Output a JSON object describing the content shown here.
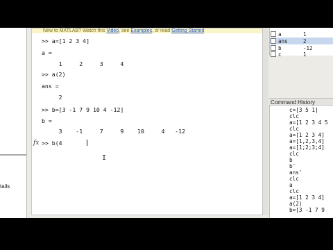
{
  "left_panel": {
    "details_label": "tails"
  },
  "command_window": {
    "banner": {
      "prefix": "New to MATLAB? Watch this",
      "video_link": "Video",
      "sep1": ", see",
      "examples_link": "Examples",
      "sep2": ", or read",
      "started_link": "Getting Started"
    },
    "lines": [
      ">> a=[1 2 3 4]",
      "a =",
      "     1     2     3     4",
      ">> a(2)",
      "ans =",
      "     2",
      ">> b=[3 -1 7 9 10 4 -12]",
      "b =",
      "     3    -1     7     9    10     4   -12",
      ">> b(4"
    ],
    "prompt_glyph": "fx",
    "cursor_glyph": "I"
  },
  "workspace": {
    "rows": [
      {
        "name": "a",
        "value": "1",
        "selected": false
      },
      {
        "name": "ans",
        "value": "2",
        "selected": true
      },
      {
        "name": "b",
        "value": "-12",
        "selected": false
      },
      {
        "name": "c",
        "value": "1",
        "selected": false
      }
    ]
  },
  "command_history": {
    "title": "Command History",
    "items": [
      "c=[3 5 1]",
      "clc",
      "a=[1 2 3 4 5",
      "clc",
      "a=[1 2 3 4]",
      "a=[1,2,3,4]",
      "a=[1;2;3;4]",
      "clc",
      "b",
      "b'",
      "ans'",
      "clc",
      "a",
      "clc",
      "a=[1 2 3 4]",
      "a(2)",
      "b=[3 -1 7 9"
    ]
  }
}
